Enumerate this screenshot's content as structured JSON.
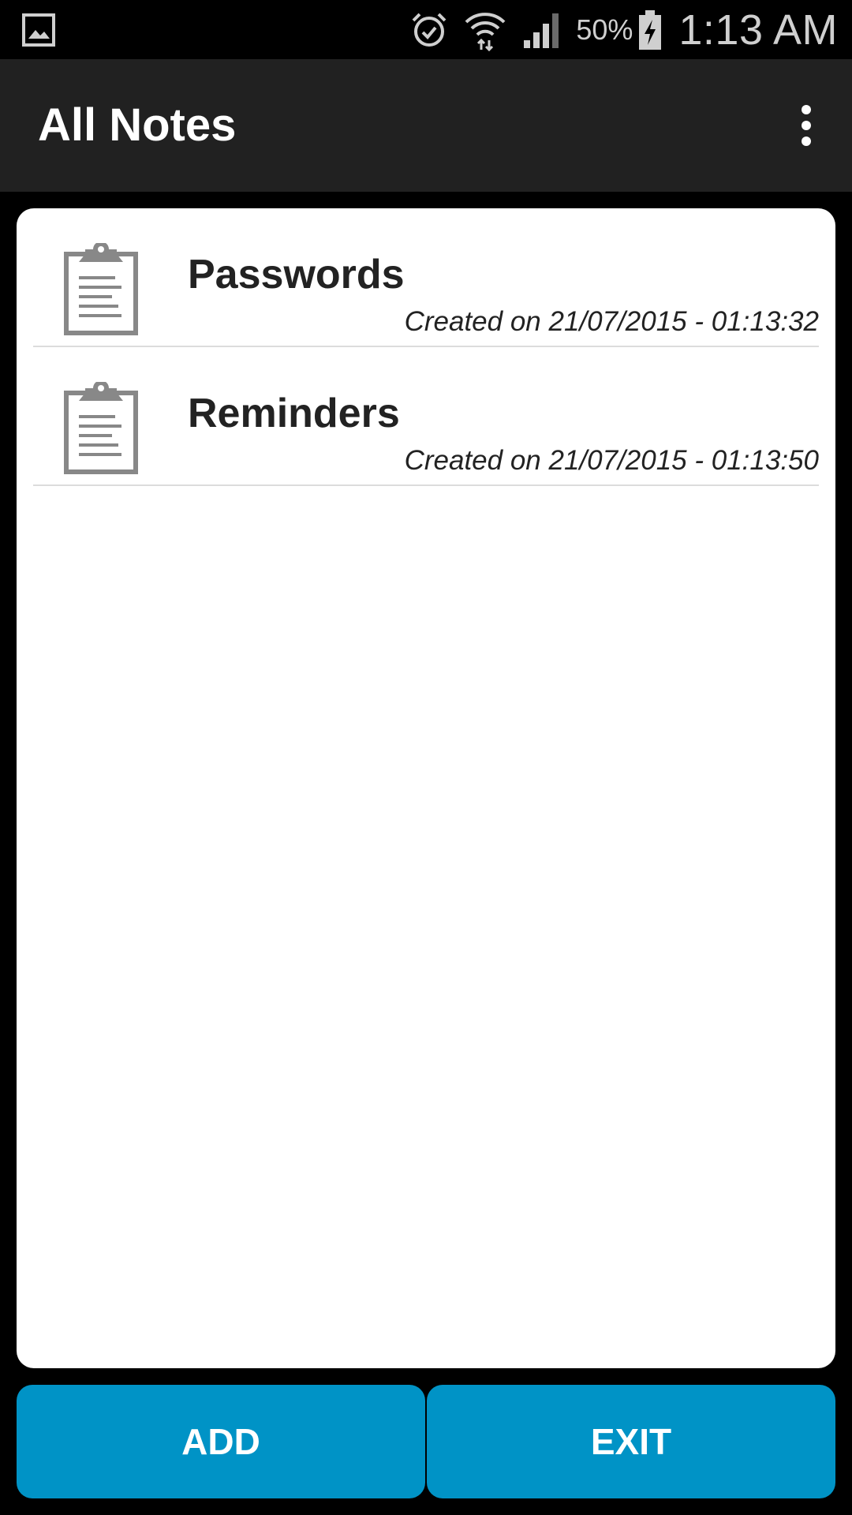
{
  "status_bar": {
    "battery_percent": "50%",
    "time": "1:13 AM",
    "icons": [
      "gallery-icon",
      "alarm-icon",
      "wifi-icon",
      "signal-icon",
      "battery-charging-icon"
    ]
  },
  "action_bar": {
    "title": "All Notes",
    "overflow_icon": "more-vert-icon"
  },
  "notes": [
    {
      "title": "Passwords",
      "created": "Created on 21/07/2015 - 01:13:32",
      "icon": "clipboard-icon"
    },
    {
      "title": "Reminders",
      "created": "Created on 21/07/2015 - 01:13:50",
      "icon": "clipboard-icon"
    }
  ],
  "buttons": {
    "add_label": "ADD",
    "exit_label": "EXIT"
  },
  "colors": {
    "status_bar_bg": "#000000",
    "action_bar_bg": "#212121",
    "panel_bg": "#ffffff",
    "button_bg": "#0093c6",
    "icon_gray": "#888888"
  }
}
